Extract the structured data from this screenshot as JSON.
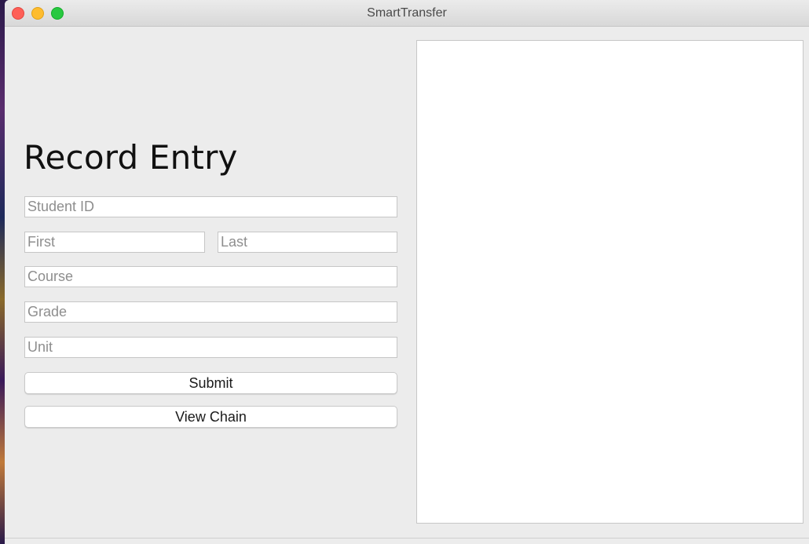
{
  "window": {
    "title": "SmartTransfer"
  },
  "form": {
    "heading": "Record Entry",
    "student_id_placeholder": "Student ID",
    "first_placeholder": "First",
    "last_placeholder": "Last",
    "course_placeholder": "Course",
    "grade_placeholder": "Grade",
    "unit_placeholder": "Unit",
    "submit_label": "Submit",
    "view_chain_label": "View Chain"
  },
  "output": {
    "text": ""
  }
}
